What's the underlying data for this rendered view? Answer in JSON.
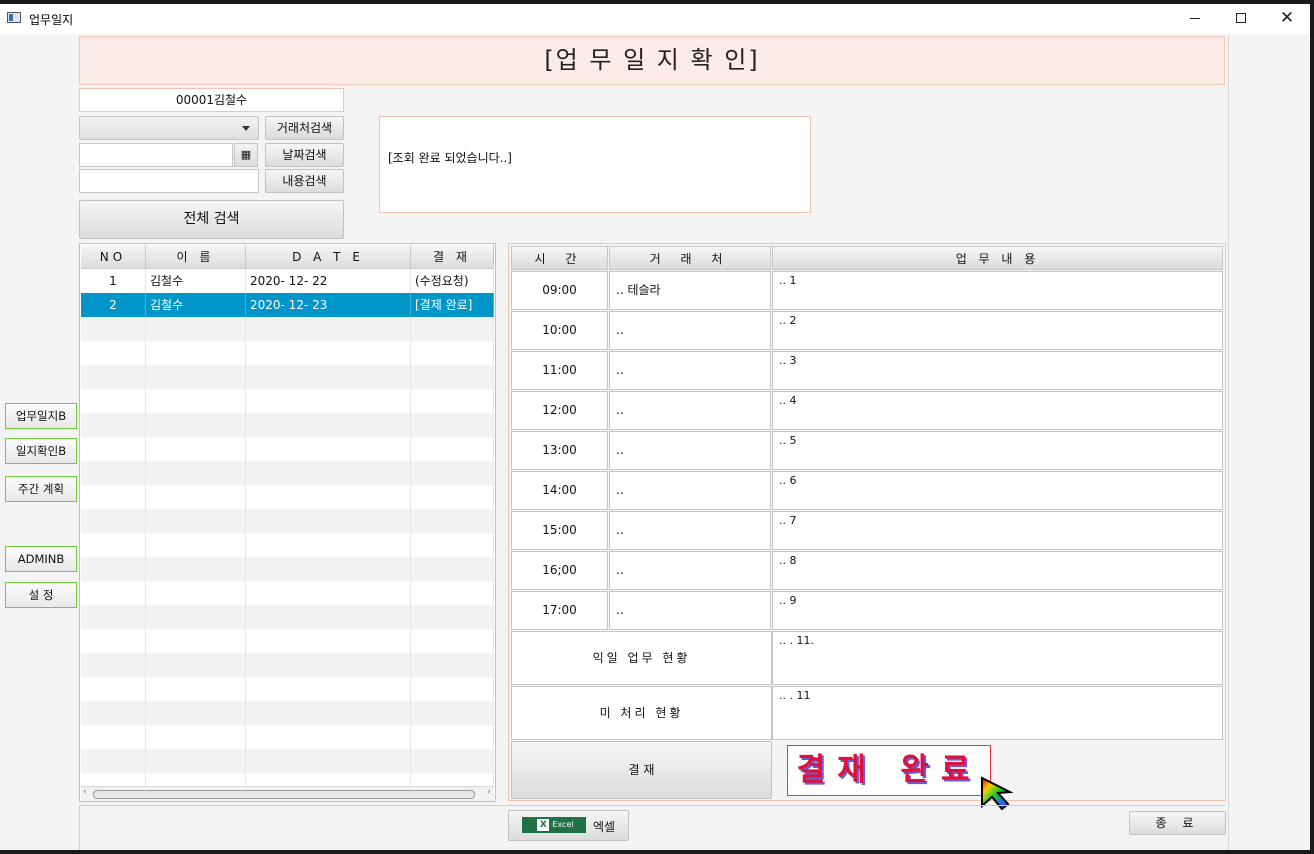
{
  "window": {
    "title": "업무일지",
    "minimize": "—",
    "maximize": "□",
    "close": "✕"
  },
  "header": {
    "title": "[업 무   일 지   확 인]"
  },
  "user": {
    "label": "00001김철수"
  },
  "search": {
    "client_button": "거래처검색",
    "date_button": "날짜검색",
    "content_button": "내용검색",
    "all_button": "전체 검색",
    "calendar_icon": "calendar-icon"
  },
  "message": {
    "text": "[조회 완료 되었습니다..]"
  },
  "table": {
    "headers": [
      "NO",
      "이  름",
      "D A T E",
      "결 재"
    ],
    "rows": [
      {
        "no": "1",
        "name": "김철수",
        "date": "2020- 12- 22",
        "status": "(수정요청)"
      },
      {
        "no": "2",
        "name": "김철수",
        "date": "2020- 12- 23",
        "status": "[결제 완료]"
      }
    ],
    "selected_index": 1
  },
  "sidebar": {
    "items": [
      {
        "label": "업무일지B"
      },
      {
        "label": "일지확인B"
      },
      {
        "label": "주간 계획"
      },
      {
        "label": "ADMINB"
      },
      {
        "label": "설  정"
      }
    ]
  },
  "schedule": {
    "headers": {
      "time": "시  간",
      "client": "거 래 처",
      "work": "업    무    내    용"
    },
    "rows": [
      {
        "time": "09:00",
        "client": ".. 테슬라",
        "work": ".. 1"
      },
      {
        "time": "10:00",
        "client": "..",
        "work": ".. 2"
      },
      {
        "time": "11:00",
        "client": "..",
        "work": ".. 3"
      },
      {
        "time": "12:00",
        "client": "..",
        "work": ".. 4"
      },
      {
        "time": "13:00",
        "client": "..",
        "work": ".. 5"
      },
      {
        "time": "14:00",
        "client": "..",
        "work": ".. 6"
      },
      {
        "time": "15:00",
        "client": "..",
        "work": ".. 7"
      },
      {
        "time": "16;00",
        "client": "..",
        "work": ".. 8"
      },
      {
        "time": "17:00",
        "client": "..",
        "work": ".. 9"
      }
    ],
    "next_day_label": "익일  업무  현황",
    "next_day_value": ".. . 11.",
    "pending_label": "미  처리   현황",
    "pending_value": ".. . 11",
    "approve_button": "결 재",
    "stamp": "결재 완료"
  },
  "footer": {
    "excel_label": "엑셀",
    "excel_badge": "Excel",
    "close_button": "종 료"
  },
  "colors": {
    "accent": "#0096c9",
    "header_bg": "#fcebe9",
    "border": "#f0c5b0",
    "sidebar_border": "#6fcc3a",
    "stamp": "#e0103a"
  }
}
